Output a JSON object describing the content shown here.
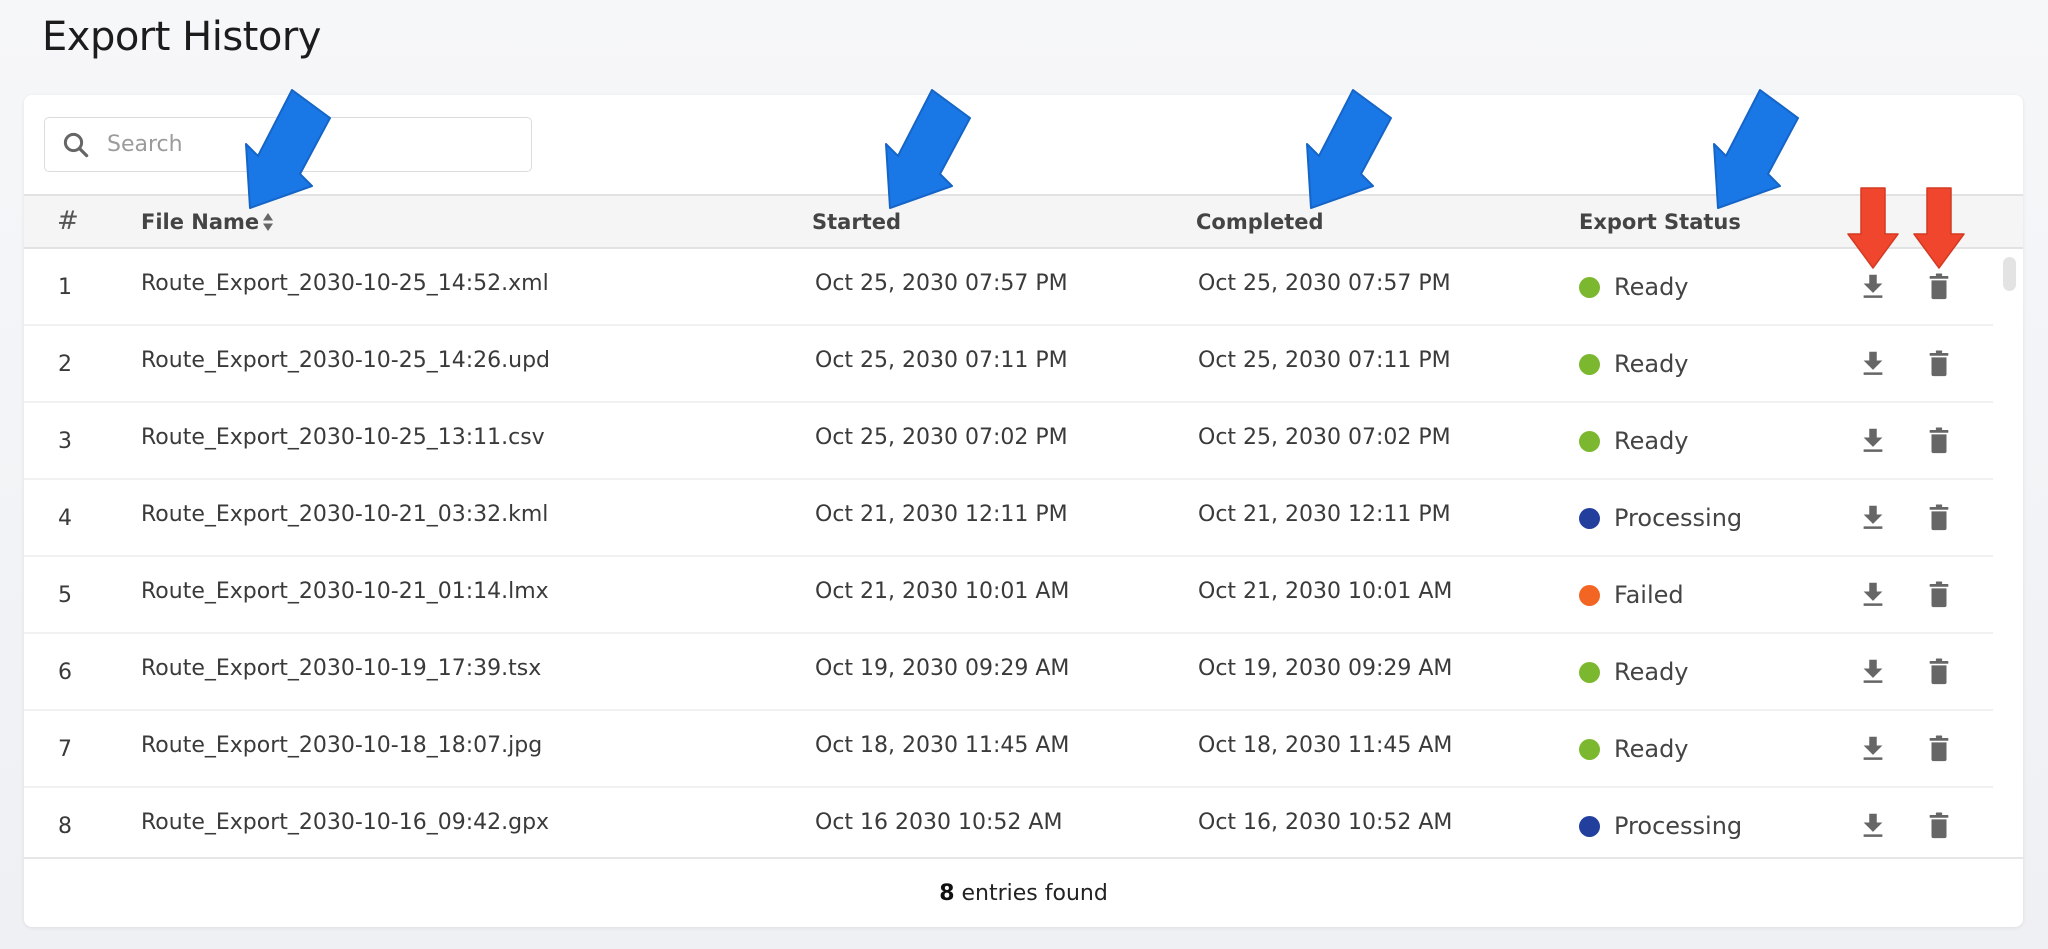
{
  "page": {
    "title": "Export History"
  },
  "search": {
    "placeholder": "Search",
    "value": "",
    "icon": "search-icon"
  },
  "table": {
    "columns": {
      "index": "#",
      "file_name": "File Name",
      "started": "Started",
      "completed": "Completed",
      "status": "Export Status"
    },
    "sort_icon": "sort-icon",
    "actions": {
      "download_icon": "download-icon",
      "delete_icon": "trash-icon"
    },
    "rows": [
      {
        "num": "1",
        "file_name": "Route_Export_2030-10-25_14:52.xml",
        "started": "Oct 25, 2030 07:57 PM",
        "completed": "Oct 25, 2030 07:57 PM",
        "status": "Ready",
        "status_color": "#7cb82f"
      },
      {
        "num": "2",
        "file_name": "Route_Export_2030-10-25_14:26.upd",
        "started": "Oct 25, 2030 07:11 PM",
        "completed": "Oct 25, 2030 07:11 PM",
        "status": "Ready",
        "status_color": "#7cb82f"
      },
      {
        "num": "3",
        "file_name": "Route_Export_2030-10-25_13:11.csv",
        "started": "Oct 25, 2030 07:02 PM",
        "completed": "Oct 25, 2030 07:02 PM",
        "status": "Ready",
        "status_color": "#7cb82f"
      },
      {
        "num": "4",
        "file_name": "Route_Export_2030-10-21_03:32.kml",
        "started": "Oct 21, 2030 12:11 PM",
        "completed": "Oct 21, 2030 12:11 PM",
        "status": "Processing",
        "status_color": "#233f9e"
      },
      {
        "num": "5",
        "file_name": "Route_Export_2030-10-21_01:14.lmx",
        "started": "Oct 21, 2030 10:01 AM",
        "completed": "Oct 21, 2030 10:01 AM",
        "status": "Failed",
        "status_color": "#f26522"
      },
      {
        "num": "6",
        "file_name": "Route_Export_2030-10-19_17:39.tsx",
        "started": "Oct 19, 2030 09:29 AM",
        "completed": "Oct 19, 2030 09:29 AM",
        "status": "Ready",
        "status_color": "#7cb82f"
      },
      {
        "num": "7",
        "file_name": "Route_Export_2030-10-18_18:07.jpg",
        "started": "Oct 18, 2030 11:45 AM",
        "completed": "Oct 18, 2030 11:45 AM",
        "status": "Ready",
        "status_color": "#7cb82f"
      },
      {
        "num": "8",
        "file_name": "Route_Export_2030-10-16_09:42.gpx",
        "started": "Oct 16 2030 10:52 AM",
        "completed": "Oct 16, 2030 10:52 AM",
        "status": "Processing",
        "status_color": "#233f9e"
      }
    ]
  },
  "footer": {
    "count": "8",
    "label": "entries found"
  },
  "annotations": {
    "blue_arrow_color": "#1a78e6",
    "red_arrow_color": "#f0462d"
  }
}
